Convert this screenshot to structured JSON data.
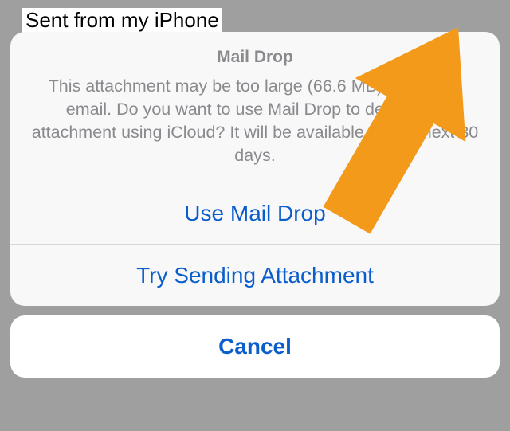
{
  "background": {
    "signature": "Sent from my iPhone"
  },
  "sheet": {
    "title": "Mail Drop",
    "message": "This attachment may be too large (66.6 MB) to send in email. Do you want to use Mail Drop to deliver the attachment using iCloud? It will be available for the next 30 days.",
    "buttons": {
      "use_mail_drop": "Use Mail Drop",
      "try_sending": "Try Sending Attachment",
      "cancel": "Cancel"
    }
  },
  "annotation": {
    "arrow_color": "#f49a1a"
  }
}
